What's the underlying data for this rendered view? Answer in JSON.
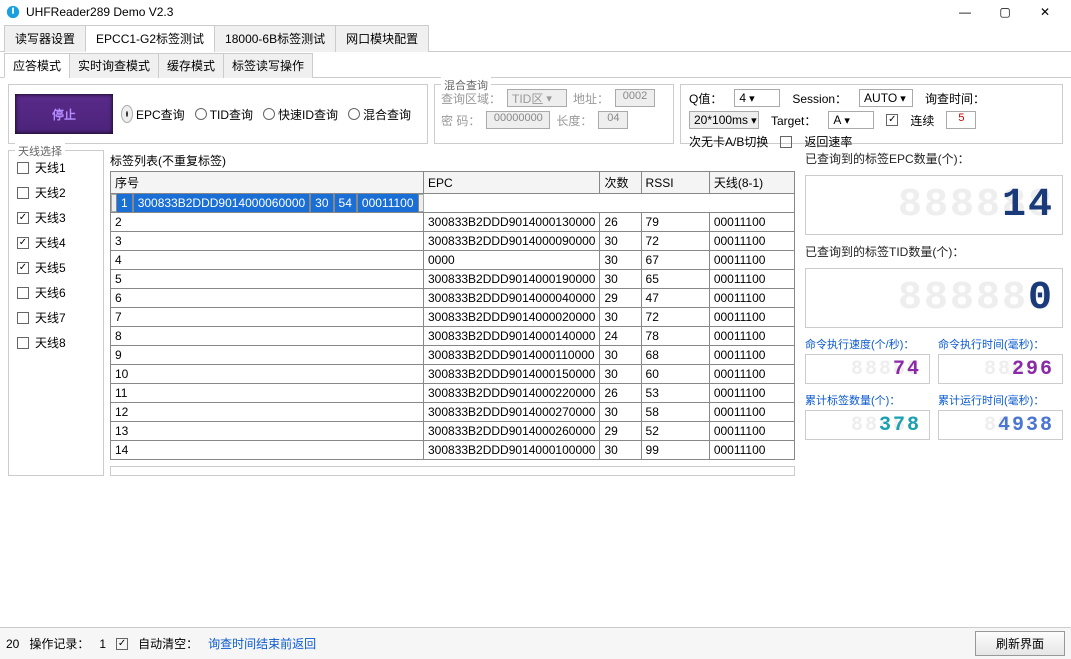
{
  "window": {
    "title": "UHFReader289 Demo V2.3"
  },
  "main_tabs": [
    "读写器设置",
    "EPCC1-G2标签测试",
    "18000-6B标签测试",
    "网口模块配置"
  ],
  "main_tab_active": 1,
  "sub_tabs": [
    "应答模式",
    "实时询查模式",
    "缓存模式",
    "标签读写操作"
  ],
  "sub_tab_active": 0,
  "stop_button": "停止",
  "query_radios": [
    "EPC查询",
    "TID查询",
    "快速ID查询",
    "混合查询"
  ],
  "query_radio_selected": 0,
  "mix": {
    "title": "混合查询",
    "area_lbl": "查询区域：",
    "area_val": "TID区",
    "addr_lbl": "地址：",
    "addr_val": "0002",
    "pwd_lbl": "密 码：",
    "pwd_val": "00000000",
    "len_lbl": "长度：",
    "len_val": "04"
  },
  "params": {
    "q_lbl": "Q值：",
    "q_val": "4",
    "session_lbl": "Session：",
    "session_val": "AUTO",
    "qtime_lbl": "询查时间：",
    "qtime_val": "20*100ms",
    "target_lbl": "Target：",
    "target_val": "A",
    "cont_lbl": "连续",
    "cont_checked": true,
    "cont_times": "5",
    "times_suffix": "次无卡A/B切换",
    "rate_lbl": "返回速率",
    "rate_checked": false
  },
  "antenna": {
    "title": "天线选择",
    "items": [
      {
        "label": "天线1",
        "checked": false
      },
      {
        "label": "天线2",
        "checked": false
      },
      {
        "label": "天线3",
        "checked": true
      },
      {
        "label": "天线4",
        "checked": true
      },
      {
        "label": "天线5",
        "checked": true
      },
      {
        "label": "天线6",
        "checked": false
      },
      {
        "label": "天线7",
        "checked": false
      },
      {
        "label": "天线8",
        "checked": false
      }
    ]
  },
  "table": {
    "title": "标签列表(不重复标签)",
    "cols": [
      "序号",
      "EPC",
      "次数",
      "RSSI",
      "天线(8-1)"
    ],
    "rows": [
      [
        "1",
        "300833B2DDD9014000060000",
        "30",
        "54",
        "00011100"
      ],
      [
        "2",
        "300833B2DDD9014000130000",
        "26",
        "79",
        "00011100"
      ],
      [
        "3",
        "300833B2DDD9014000090000",
        "30",
        "72",
        "00011100"
      ],
      [
        "4",
        "0000",
        "30",
        "67",
        "00011100"
      ],
      [
        "5",
        "300833B2DDD9014000190000",
        "30",
        "65",
        "00011100"
      ],
      [
        "6",
        "300833B2DDD9014000040000",
        "29",
        "47",
        "00011100"
      ],
      [
        "7",
        "300833B2DDD9014000020000",
        "30",
        "72",
        "00011100"
      ],
      [
        "8",
        "300833B2DDD9014000140000",
        "24",
        "78",
        "00011100"
      ],
      [
        "9",
        "300833B2DDD9014000110000",
        "30",
        "68",
        "00011100"
      ],
      [
        "10",
        "300833B2DDD9014000150000",
        "30",
        "60",
        "00011100"
      ],
      [
        "11",
        "300833B2DDD9014000220000",
        "26",
        "53",
        "00011100"
      ],
      [
        "12",
        "300833B2DDD9014000270000",
        "30",
        "58",
        "00011100"
      ],
      [
        "13",
        "300833B2DDD9014000260000",
        "29",
        "52",
        "00011100"
      ],
      [
        "14",
        "300833B2DDD9014000100000",
        "30",
        "99",
        "00011100"
      ]
    ],
    "selected_row": 0
  },
  "stats": {
    "epc_count_lbl": "已查询到的标签EPC数量(个)：",
    "epc_count": "14",
    "tid_count_lbl": "已查询到的标签TID数量(个)：",
    "tid_count": "0",
    "speed_lbl": "命令执行速度(个/秒)：",
    "speed": "74",
    "exec_time_lbl": "命令执行时间(毫秒)：",
    "exec_time": "296",
    "total_tags_lbl": "累计标签数量(个)：",
    "total_tags": "378",
    "total_time_lbl": "累计运行时间(毫秒)：",
    "total_time": "4938"
  },
  "footer": {
    "prefix": "20",
    "log_lbl": "操作记录：",
    "log_count": "1",
    "autoclear_lbl": "自动清空：",
    "autoclear_checked": true,
    "log_text": "询查时间结束前返回",
    "refresh_btn": "刷新界面"
  }
}
